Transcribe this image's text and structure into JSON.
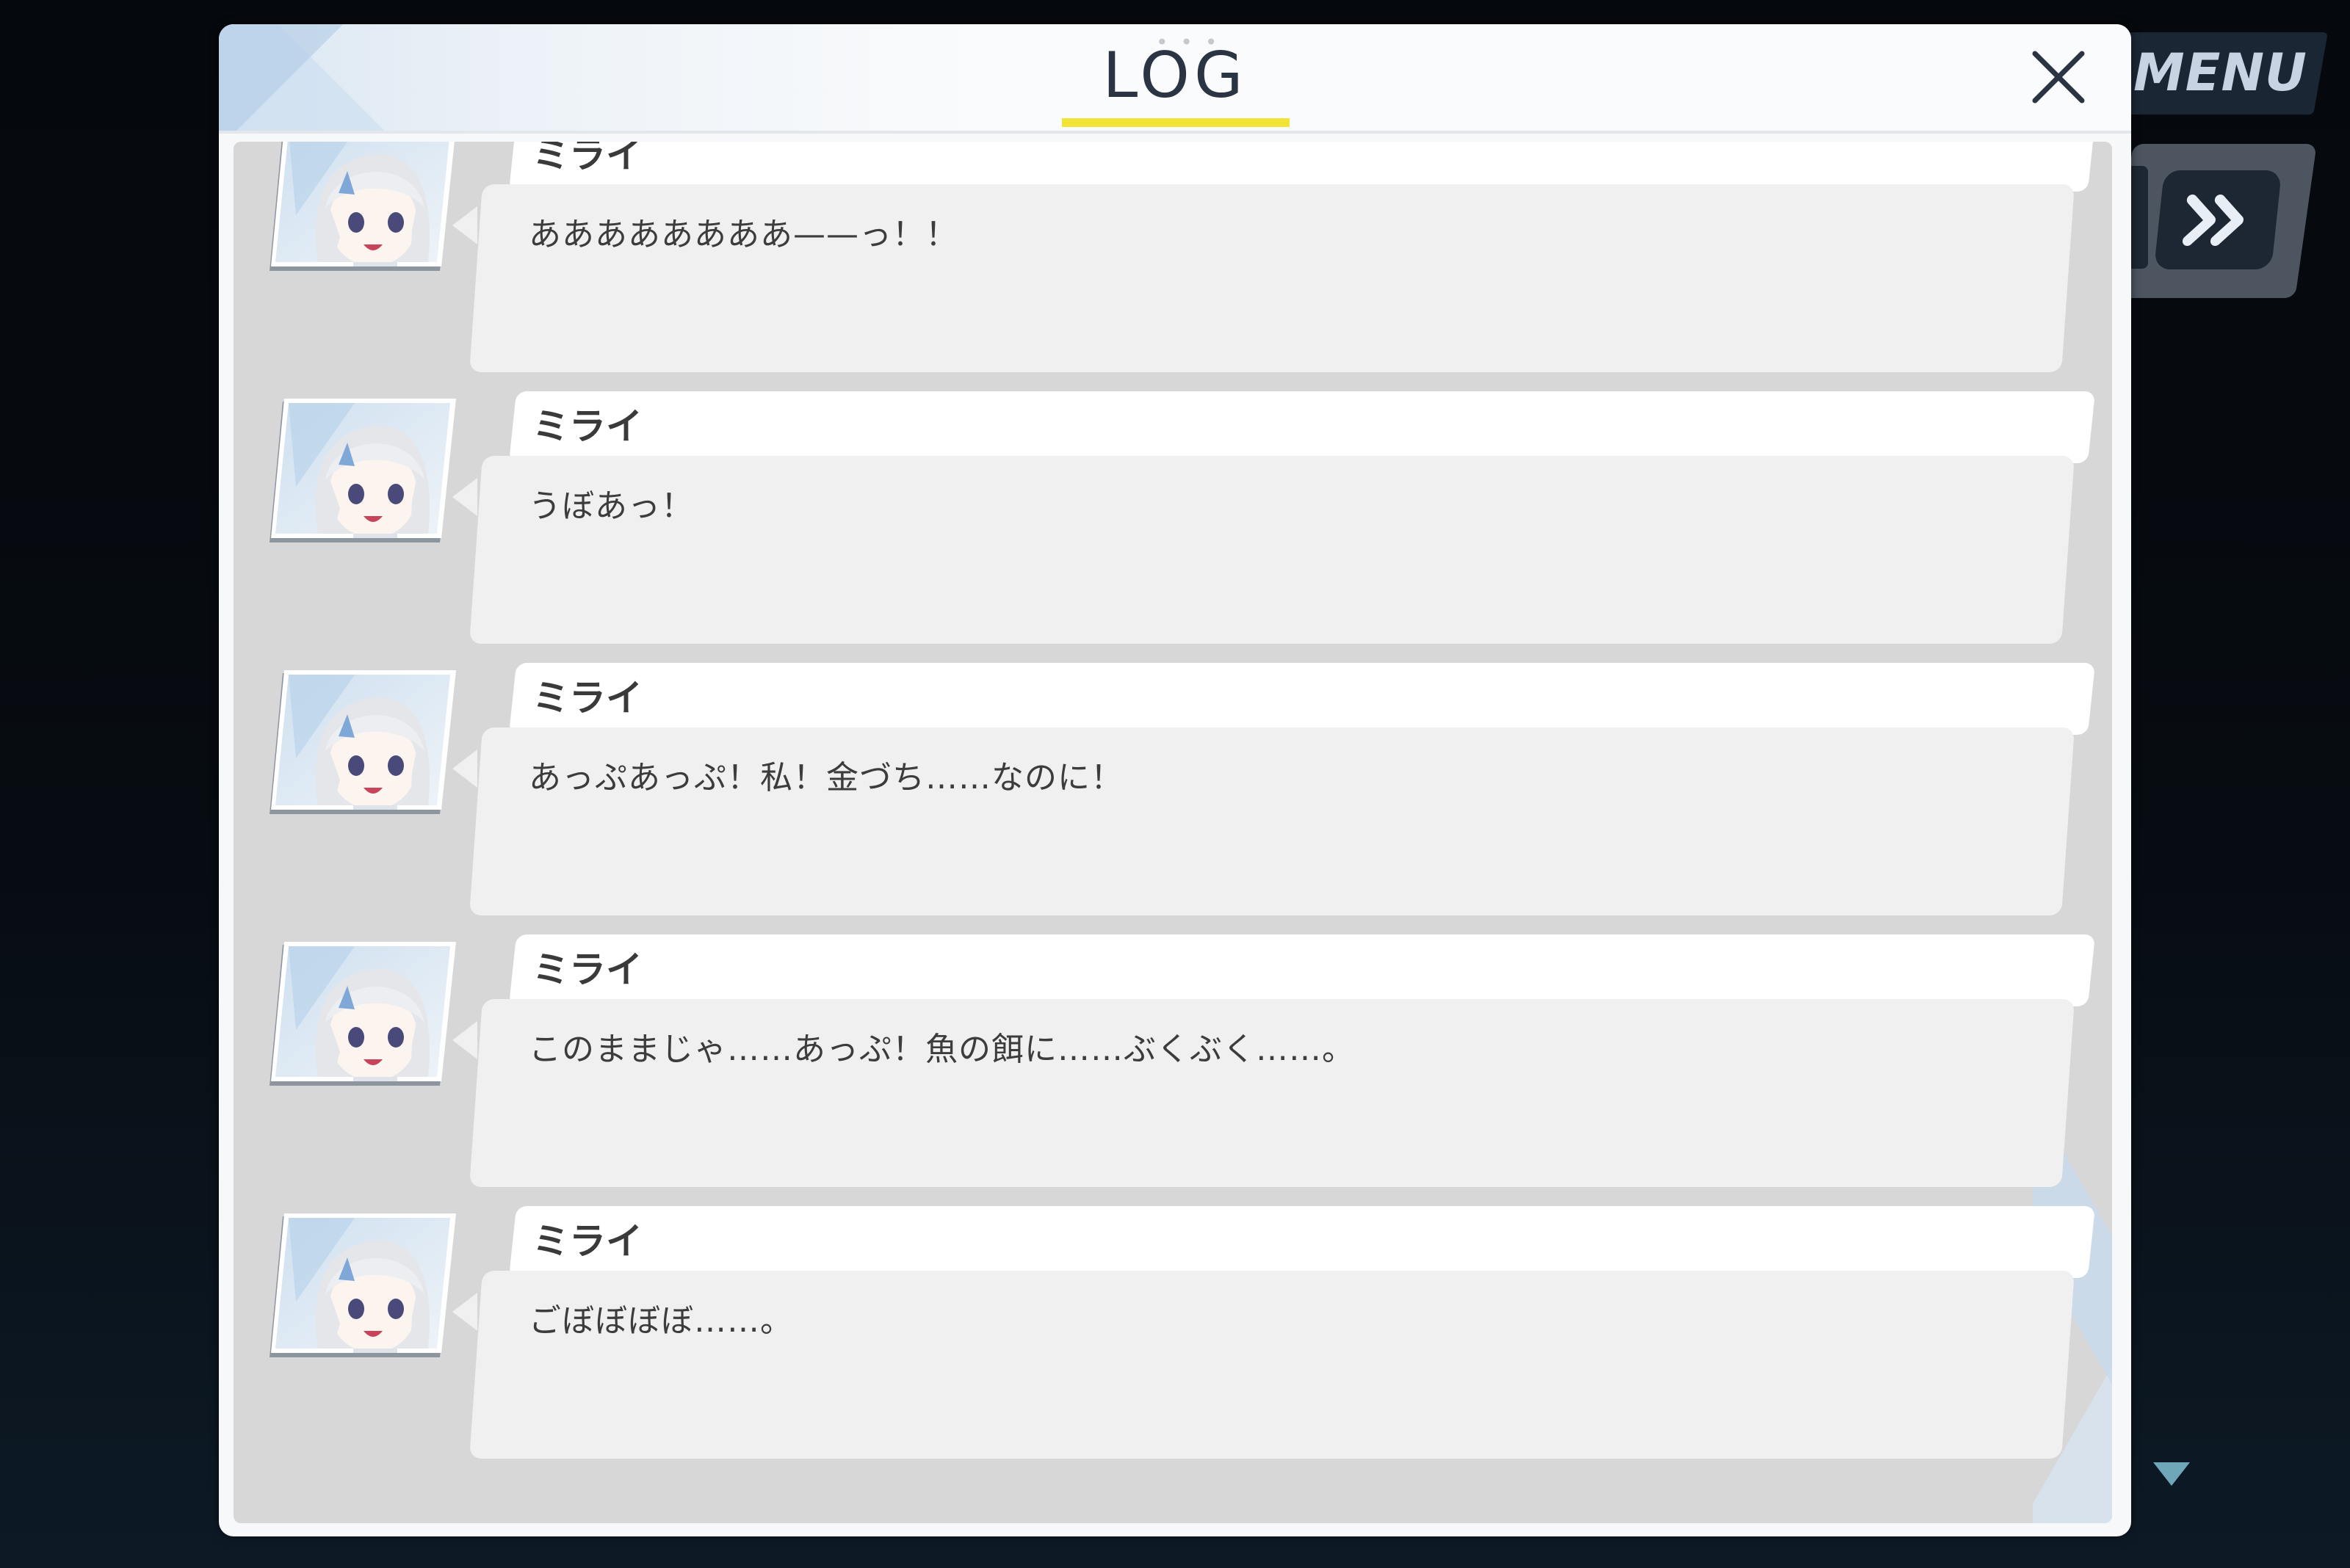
{
  "game_ui": {
    "menu_label": "MENU",
    "fast_forward_icon": "double-chevron-right-icon"
  },
  "dialog": {
    "title": "LOG",
    "close_icon": "close-icon",
    "accent_color": "#f1e437"
  },
  "log_entries": [
    {
      "speaker": "ミライ",
      "text": "ああああああああ——っ！！"
    },
    {
      "speaker": "ミライ",
      "text": "うぼあっ！"
    },
    {
      "speaker": "ミライ",
      "text": "あっぷあっぷ！私！金づち……なのに！"
    },
    {
      "speaker": "ミライ",
      "text": "このままじゃ……あっぷ！魚の餌に……ぶくぶく……。"
    },
    {
      "speaker": "ミライ",
      "text": "ごぼぼぼぼ……。"
    }
  ]
}
